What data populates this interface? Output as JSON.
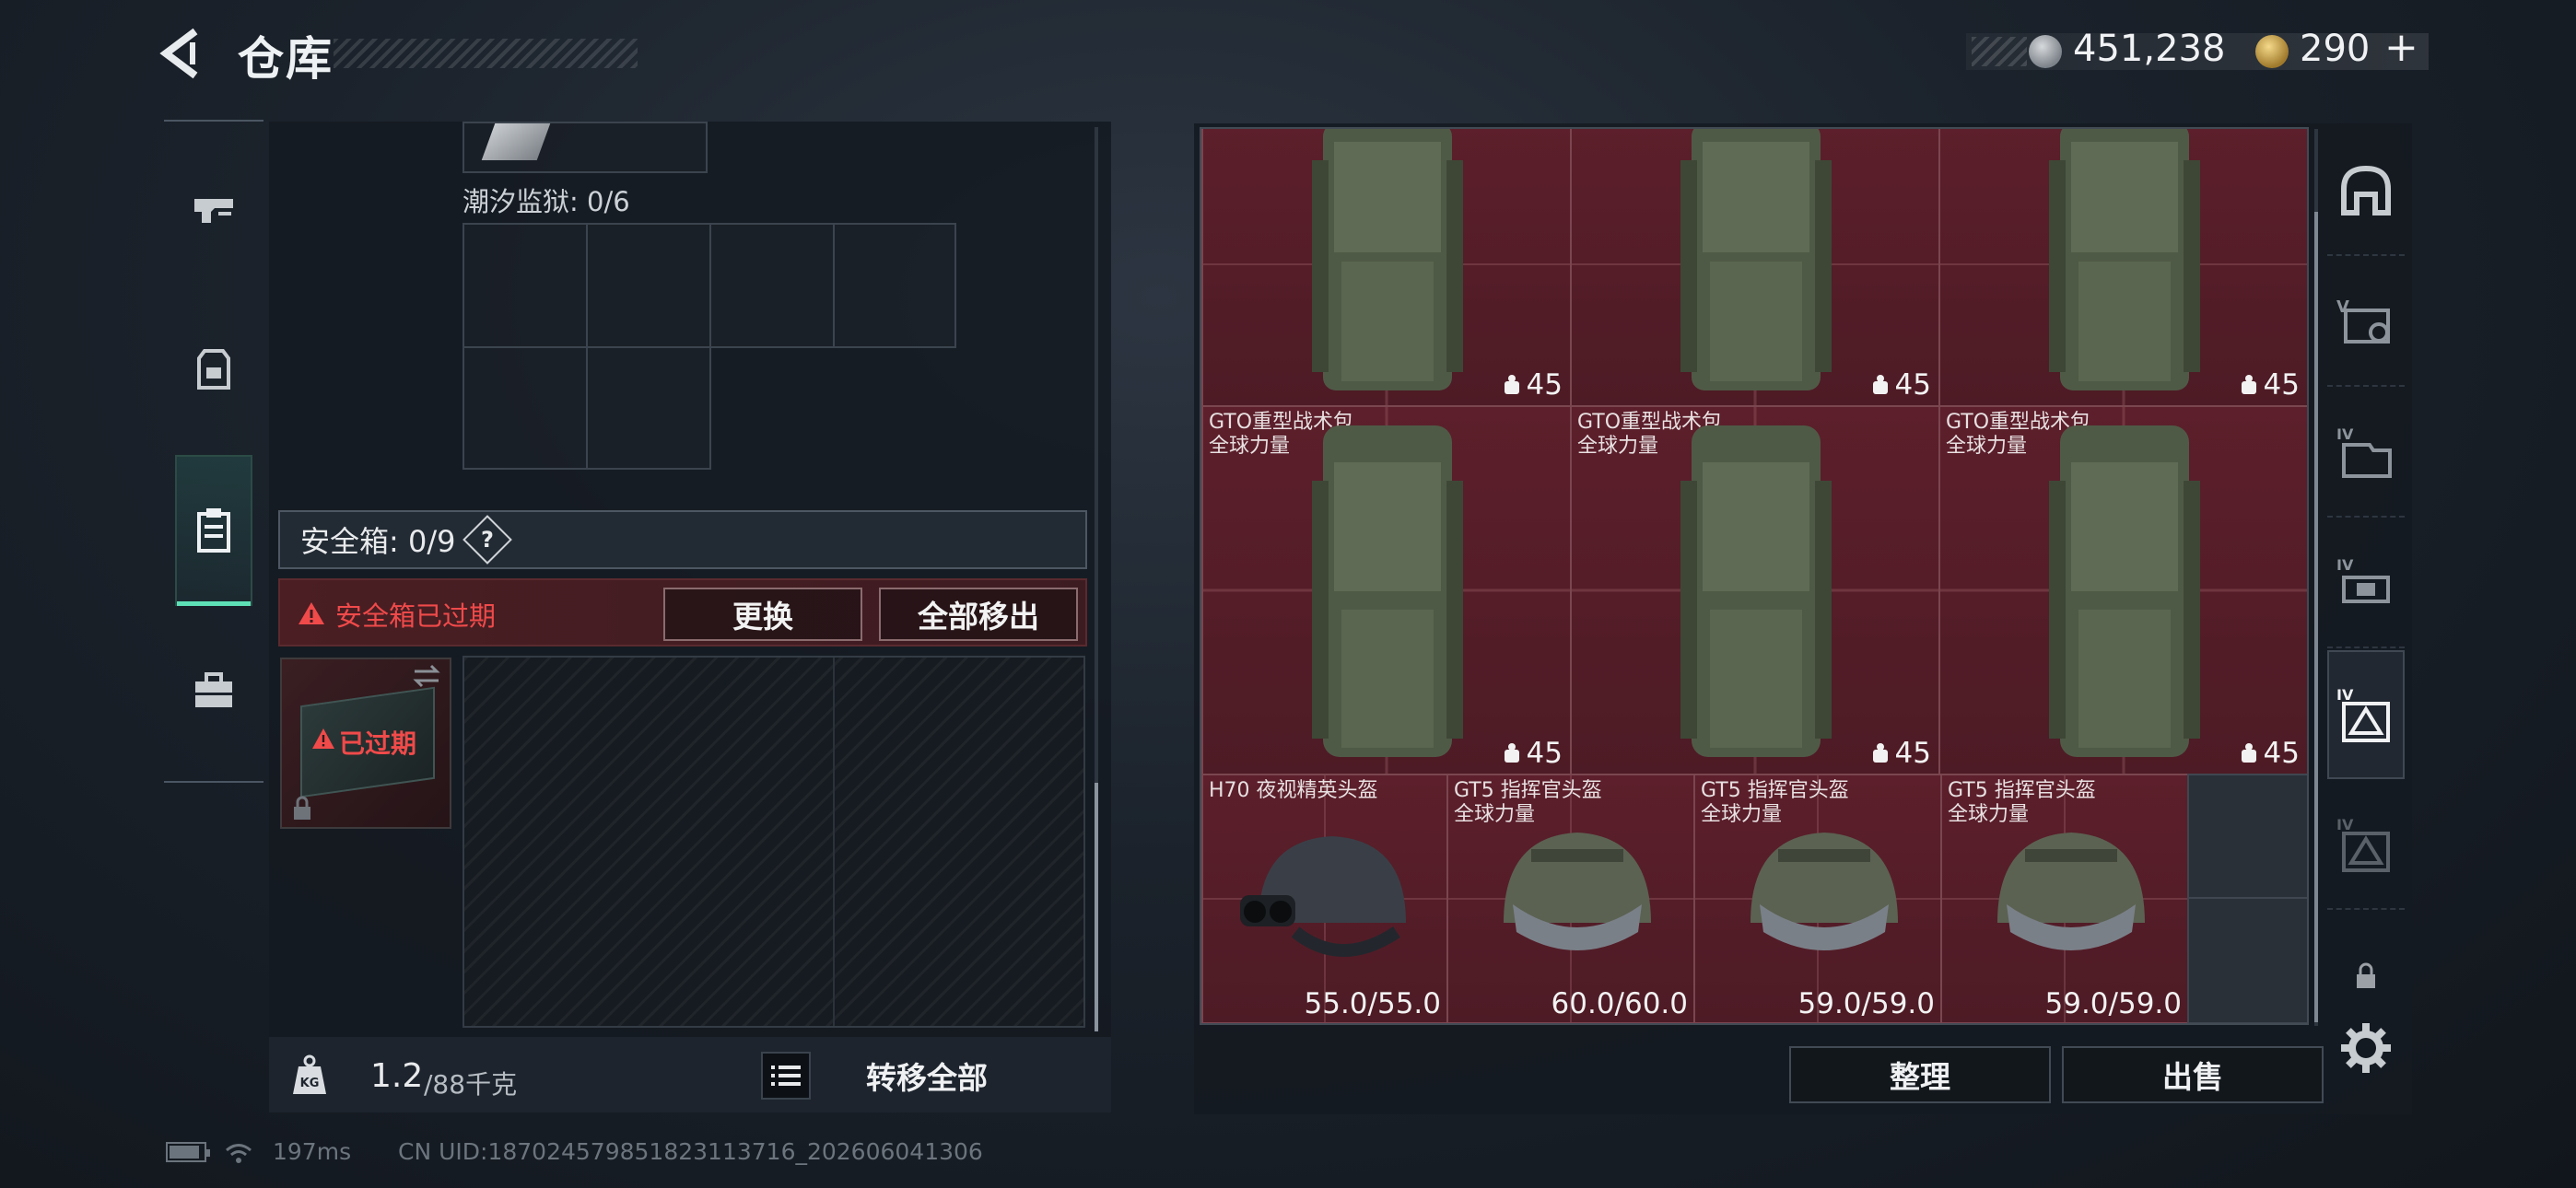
{
  "header": {
    "title": "仓库",
    "currency": [
      {
        "name": "silver-coin",
        "value": "451,238",
        "color": "#b5babf"
      },
      {
        "name": "gold-coin",
        "value": "290",
        "color": "#d4a84a"
      }
    ],
    "plus": "+"
  },
  "left_rail": {
    "items": [
      {
        "icon": "pistol-icon",
        "selected": false
      },
      {
        "icon": "backpack-icon",
        "selected": false
      },
      {
        "icon": "clipboard-icon",
        "selected": true
      },
      {
        "icon": "briefcase-icon",
        "selected": false
      }
    ]
  },
  "left_panel": {
    "prison_label": "潮汐监狱: 0/6",
    "safe_label": "安全箱: 0/9",
    "help_label": "?",
    "expired_notice": "安全箱已过期",
    "replace_button": "更换",
    "move_all_button": "全部移出",
    "case_status": "已过期",
    "weight_current": "1.2",
    "weight_max": "/88千克",
    "transfer_all_button": "转移全部"
  },
  "right_panel": {
    "bags": [
      {
        "name": "",
        "sub": "",
        "capacity": "45"
      },
      {
        "name": "",
        "sub": "",
        "capacity": "45"
      },
      {
        "name": "",
        "sub": "",
        "capacity": "45"
      },
      {
        "name": "GTO重型战术包",
        "sub": "全球力量",
        "capacity": "45"
      },
      {
        "name": "GTO重型战术包",
        "sub": "全球力量",
        "capacity": "45"
      },
      {
        "name": "GTO重型战术包",
        "sub": "全球力量",
        "capacity": "45"
      }
    ],
    "helmets": [
      {
        "name": "H70 夜视精英头盔",
        "sub": "",
        "durability": "55.0/55.0"
      },
      {
        "name": "GT5 指挥官头盔",
        "sub": "全球力量",
        "durability": "60.0/60.0"
      },
      {
        "name": "GT5 指挥官头盔",
        "sub": "全球力量",
        "durability": "59.0/59.0"
      },
      {
        "name": "GT5 指挥官头盔",
        "sub": "全球力量",
        "durability": "59.0/59.0"
      }
    ],
    "sort_button": "整理",
    "sell_button": "出售"
  },
  "right_rail": {
    "items": [
      {
        "icon": "helmet-slot-icon"
      },
      {
        "icon": "armor-v-icon"
      },
      {
        "icon": "backpack-iv-icon"
      },
      {
        "icon": "rig-iv-icon"
      },
      {
        "icon": "safe-iv-icon",
        "selected": true
      },
      {
        "icon": "safe-iv-dim-icon"
      },
      {
        "icon": "lock-icon"
      },
      {
        "icon": "gear-icon"
      }
    ]
  },
  "status": {
    "ping": "197ms",
    "uid": "CN UID:1870245798518231137​16_202606041306"
  }
}
